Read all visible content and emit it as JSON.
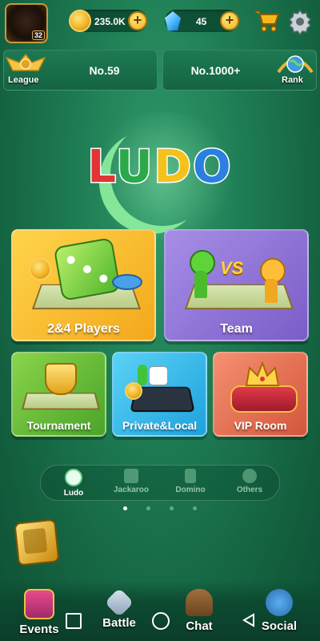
{
  "top_bar": {
    "avatar_level": "32",
    "coins": "235.0K",
    "gems": "45"
  },
  "rank_bar": {
    "league_label": "League",
    "league_rank": "No.59",
    "global_rank": "No.1000+",
    "rank_label": "Rank"
  },
  "logo": {
    "letters": [
      "L",
      "U",
      "D",
      "O"
    ],
    "colors": [
      "#e23434",
      "#2aa84a",
      "#f4c21b",
      "#2a7fe0"
    ]
  },
  "modes": {
    "two_four_players": "2&4 Players",
    "team": "Team",
    "team_vs": "VS",
    "tournament": "Tournament",
    "private_local": "Private&Local",
    "vip_room": "VIP Room"
  },
  "game_tabs": [
    {
      "label": "Ludo",
      "active": true
    },
    {
      "label": "Jackaroo",
      "active": false
    },
    {
      "label": "Domino",
      "active": false
    },
    {
      "label": "Others",
      "active": false
    }
  ],
  "page_indicator": {
    "count": 4,
    "active": 0
  },
  "bottom_nav": [
    {
      "label": "Events"
    },
    {
      "label": "Battle"
    },
    {
      "label": "Chat"
    },
    {
      "label": "Social"
    }
  ],
  "colors": {
    "background": "#1d7a52",
    "gold": "#f2b51b",
    "yellow_card": "#f3b81c",
    "purple_card": "#8a6fd0",
    "green_card": "#5fb832",
    "blue_card": "#27b3e6",
    "red_card": "#e06a4a"
  },
  "icons": {
    "settings": "gear-icon",
    "shop": "cart-icon",
    "coin": "coin-icon",
    "gem": "gem-icon"
  }
}
